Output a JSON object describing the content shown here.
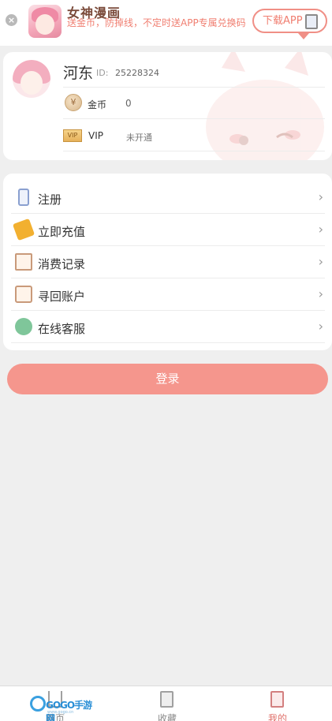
{
  "banner": {
    "close_symbol": "×",
    "app_icon": "anime-girl-app-icon",
    "title": "女神漫画",
    "description": "送金币，防掉线，不定时送APP专属兑换码",
    "download_label": "下载APP",
    "download_icon": "phone-download-icon"
  },
  "profile": {
    "username": "河东",
    "id_label": "ID:",
    "id_value": "25228324",
    "coin_label": "金币",
    "coin_value": "0",
    "coin_icon_symbol": "¥",
    "vip_icon_text": "VIP",
    "vip_label": "VIP",
    "vip_value": "未开通"
  },
  "menu": {
    "items": [
      {
        "label": "注册",
        "icon": "phone-icon"
      },
      {
        "label": "立即充值",
        "icon": "ticket-icon"
      },
      {
        "label": "消费记录",
        "icon": "receipt-icon"
      },
      {
        "label": "寻回账户",
        "icon": "id-card-icon"
      },
      {
        "label": "在线客服",
        "icon": "chat-bubble-icon"
      }
    ],
    "arrow": "›"
  },
  "login_label": "登录",
  "nav": {
    "items": [
      {
        "label": "首页",
        "icon": "home-icon"
      },
      {
        "label": "收藏",
        "icon": "bookmark-icon"
      },
      {
        "label": "我的",
        "icon": "profile-book-icon"
      }
    ]
  },
  "watermark": {
    "text": "GOGO手游网",
    "sub": "www.gogo.cn"
  },
  "colors": {
    "accent": "#f5968d",
    "background": "#efefef",
    "active_nav": "#e0706a"
  }
}
